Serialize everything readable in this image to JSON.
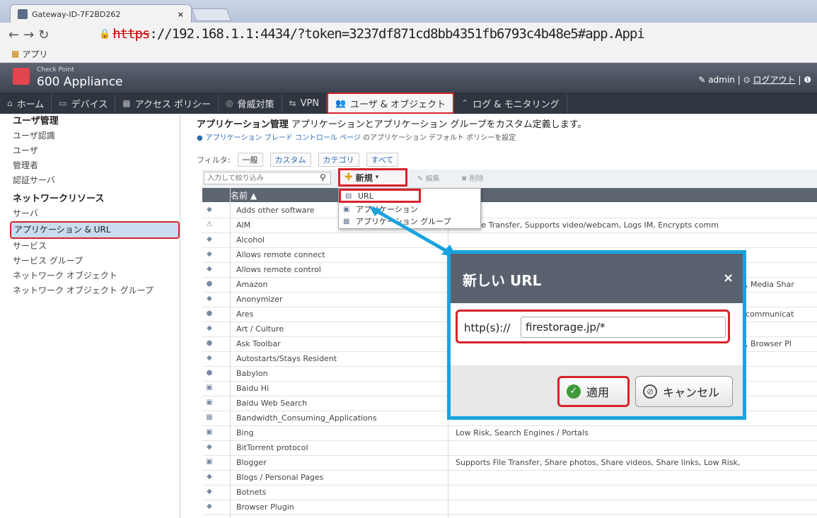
{
  "browser": {
    "tab_title": "Gateway-ID-7F2BD262",
    "tab_close": "×",
    "url_proto": "https",
    "url_rest": "://192.168.1.1:4434/?token=3237df871cd8bb4351fb6793c4b48e5#app.Appi",
    "bookmark_apps": "アプリ"
  },
  "header": {
    "brand_small": "Check Point",
    "brand": "600 Appliance",
    "user": "admin",
    "logout": "ログアウト"
  },
  "nav": [
    {
      "icon": "home-icon",
      "label": "ホーム"
    },
    {
      "icon": "devices-icon",
      "label": "デバイス"
    },
    {
      "icon": "access-policy-icon",
      "label": "アクセス ポリシー"
    },
    {
      "icon": "threat-icon",
      "label": "脅威対策"
    },
    {
      "icon": "vpn-icon",
      "label": "VPN"
    },
    {
      "icon": "users-icon",
      "label": "ユーザ & オブジェクト",
      "active": true
    },
    {
      "icon": "monitor-icon",
      "label": "ログ & モニタリング"
    }
  ],
  "sidebar": {
    "sections": [
      {
        "title": "ユーザ管理",
        "items": [
          "ユーザ認識",
          "ユーザ",
          "管理者",
          "認証サーバ"
        ]
      },
      {
        "title": "ネットワークリソース",
        "items": [
          "サーバ",
          "アプリケーション & URL",
          "サービス",
          "サービス グループ",
          "ネットワーク オブジェクト",
          "ネットワーク オブジェクト グループ"
        ]
      }
    ],
    "active": "アプリケーション & URL"
  },
  "content": {
    "title_bold": "アプリケーション管理",
    "title_rest": " アプリケーションとアプリケーション グループをカスタム定義します。",
    "subtitle_link": "アプリケーション ブレード コントロール ページ",
    "subtitle_rest": " のアプリケーション デフォルト ポリシーを設定",
    "filter_label": "フィルタ:",
    "filters": [
      "一般",
      "カスタム",
      "カテゴリ",
      "すべて"
    ],
    "search_placeholder": "入力して絞り込み",
    "new_button": "新規",
    "edit_button": "編集",
    "delete_button": "削除",
    "column_name": "名前 ▲"
  },
  "rows": [
    {
      "name": "Adds other software",
      "desc": ""
    },
    {
      "name": "AIM",
      "desc": "orts File Transfer, Supports video/webcam, Logs IM, Encrypts comm"
    },
    {
      "name": "Alcohol",
      "desc": ""
    },
    {
      "name": "Allows remote connect",
      "desc": ""
    },
    {
      "name": "Allows remote control",
      "desc": ""
    },
    {
      "name": "Amazon",
      "desc": "",
      "tail": ", Media Shar"
    },
    {
      "name": "Anonymizer",
      "desc": ""
    },
    {
      "name": "Ares",
      "desc": "",
      "tail": " communicat"
    },
    {
      "name": "Art / Culture",
      "desc": ""
    },
    {
      "name": "Ask Toolbar",
      "desc": "",
      "tail": ", Browser Pl"
    },
    {
      "name": "Autostarts/Stays Resident",
      "desc": ""
    },
    {
      "name": "Babylon",
      "desc": ""
    },
    {
      "name": "Baidu Hi",
      "desc": ""
    },
    {
      "name": "Baidu Web Search",
      "desc": ""
    },
    {
      "name": "Bandwidth_Consuming_Applications",
      "desc": ""
    },
    {
      "name": "Bing",
      "desc": "Low Risk, Search Engines / Portals"
    },
    {
      "name": "BitTorrent protocol",
      "desc": ""
    },
    {
      "name": "Blogger",
      "desc": "Supports File Transfer, Share photos, Share videos, Share links, Low Risk,"
    },
    {
      "name": "Blogs / Personal Pages",
      "desc": ""
    },
    {
      "name": "Botnets",
      "desc": ""
    },
    {
      "name": "Browser Plugin",
      "desc": ""
    }
  ],
  "dropdown": {
    "items": [
      "URL",
      "アプリケーション",
      "アプリケーション グループ"
    ]
  },
  "dialog": {
    "title": "新しい URL",
    "close": "×",
    "prefix": "http(s)://",
    "value": "firestorage.jp/*",
    "apply": "適用",
    "cancel": "キャンセル"
  },
  "colors": {
    "highlight": "#d8232a",
    "dialog_border": "#19a3de",
    "header": "#5a6270"
  }
}
